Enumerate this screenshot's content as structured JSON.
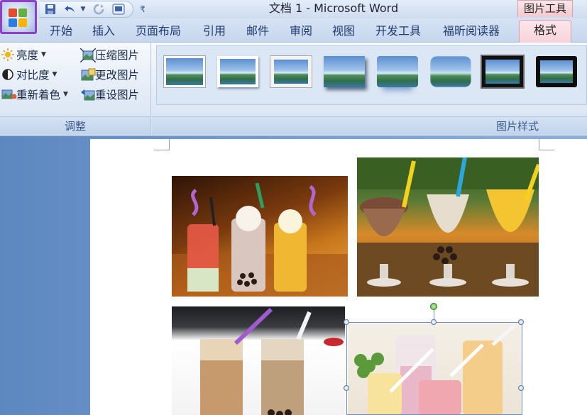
{
  "title_bar": {
    "document_title": "文档 1 - Microsoft Word",
    "context_tool_label": "图片工具",
    "quick_access": {
      "save_icon": "save-icon",
      "undo_icon": "undo-icon",
      "redo_icon": "redo-icon",
      "view_icon": "print-preview-icon",
      "customize_icon": "customize-arrow-icon"
    }
  },
  "tabs": [
    {
      "label": "开始",
      "active": false
    },
    {
      "label": "插入",
      "active": false
    },
    {
      "label": "页面布局",
      "active": false
    },
    {
      "label": "引用",
      "active": false
    },
    {
      "label": "邮件",
      "active": false
    },
    {
      "label": "审阅",
      "active": false
    },
    {
      "label": "视图",
      "active": false
    },
    {
      "label": "开发工具",
      "active": false
    },
    {
      "label": "福昕阅读器",
      "active": false
    },
    {
      "label": "格式",
      "active": true
    }
  ],
  "ribbon": {
    "adjust_group": {
      "label": "调整",
      "brightness": "亮度",
      "contrast": "对比度",
      "recolor": "重新着色",
      "compress": "压缩图片",
      "change_picture": "更改图片",
      "reset_picture": "重设图片"
    },
    "styles_group": {
      "label": "图片样式",
      "thumbnail_count": 8
    }
  },
  "colors": {
    "ribbon_bg": "#dfe8f5",
    "active_tab": "#f6d2d9",
    "office_button_border": "#8e3fc7",
    "doc_background": "#6e97ca"
  }
}
